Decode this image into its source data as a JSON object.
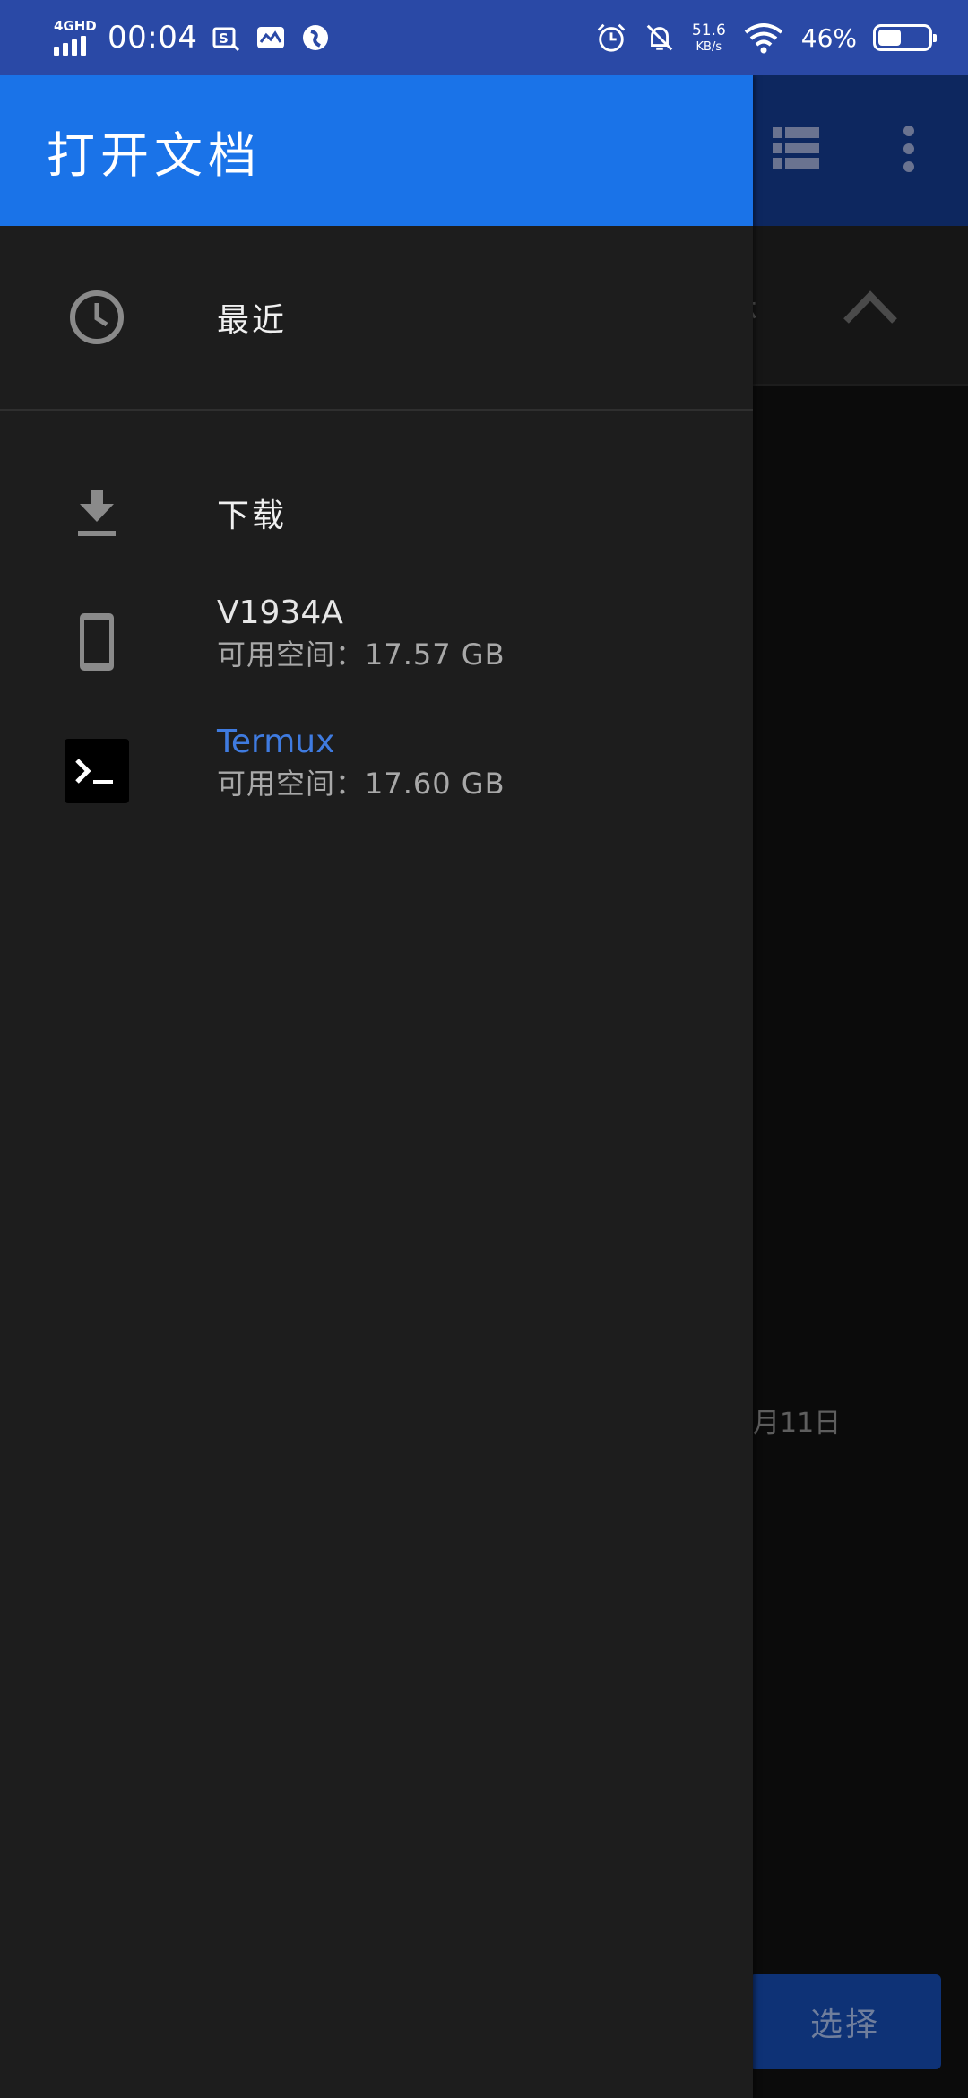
{
  "status_bar": {
    "network": "4GHD",
    "time": "00:04",
    "speed_value": "51.6",
    "speed_unit": "KB/s",
    "battery_percent": "46%",
    "battery_level": 0.46,
    "icons": [
      "screenshot-icon",
      "mail-icon",
      "browser-icon",
      "alarm-icon",
      "bell-off-icon",
      "wifi-icon",
      "battery-icon"
    ]
  },
  "drawer": {
    "title": "打开文档",
    "items": [
      {
        "label": "最近",
        "icon": "clock-icon"
      },
      {
        "label": "下载",
        "icon": "download-icon"
      },
      {
        "name": "V1934A",
        "detail": "可用空间：17.57 GB",
        "icon": "phone-icon"
      },
      {
        "name": "Termux",
        "detail": "可用空间：17.60 GB",
        "icon": "terminal-icon"
      }
    ]
  },
  "background": {
    "header_fragment": "ホ",
    "date_fragment": "月11日",
    "select_button": "选择",
    "icons": [
      "list-view-icon",
      "more-vert-icon",
      "chevron-up-icon"
    ]
  },
  "colors": {
    "status_bar": "#2a49a6",
    "drawer_header": "#1a73e8",
    "drawer_bg": "#1d1d1d",
    "accent_text": "#3f7be0"
  }
}
